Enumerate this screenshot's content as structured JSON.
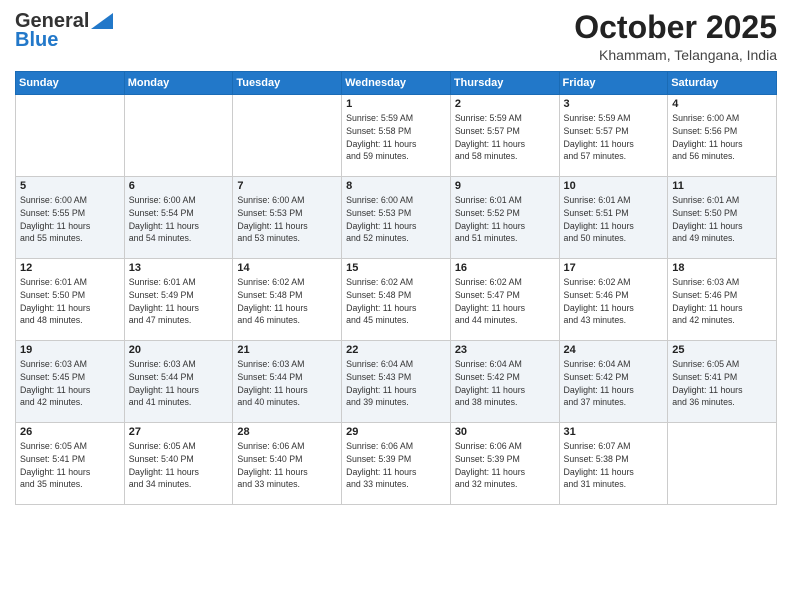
{
  "header": {
    "logo_general": "General",
    "logo_blue": "Blue",
    "month": "October 2025",
    "location": "Khammam, Telangana, India"
  },
  "weekdays": [
    "Sunday",
    "Monday",
    "Tuesday",
    "Wednesday",
    "Thursday",
    "Friday",
    "Saturday"
  ],
  "weeks": [
    [
      {
        "day": "",
        "info": ""
      },
      {
        "day": "",
        "info": ""
      },
      {
        "day": "",
        "info": ""
      },
      {
        "day": "1",
        "info": "Sunrise: 5:59 AM\nSunset: 5:58 PM\nDaylight: 11 hours\nand 59 minutes."
      },
      {
        "day": "2",
        "info": "Sunrise: 5:59 AM\nSunset: 5:57 PM\nDaylight: 11 hours\nand 58 minutes."
      },
      {
        "day": "3",
        "info": "Sunrise: 5:59 AM\nSunset: 5:57 PM\nDaylight: 11 hours\nand 57 minutes."
      },
      {
        "day": "4",
        "info": "Sunrise: 6:00 AM\nSunset: 5:56 PM\nDaylight: 11 hours\nand 56 minutes."
      }
    ],
    [
      {
        "day": "5",
        "info": "Sunrise: 6:00 AM\nSunset: 5:55 PM\nDaylight: 11 hours\nand 55 minutes."
      },
      {
        "day": "6",
        "info": "Sunrise: 6:00 AM\nSunset: 5:54 PM\nDaylight: 11 hours\nand 54 minutes."
      },
      {
        "day": "7",
        "info": "Sunrise: 6:00 AM\nSunset: 5:53 PM\nDaylight: 11 hours\nand 53 minutes."
      },
      {
        "day": "8",
        "info": "Sunrise: 6:00 AM\nSunset: 5:53 PM\nDaylight: 11 hours\nand 52 minutes."
      },
      {
        "day": "9",
        "info": "Sunrise: 6:01 AM\nSunset: 5:52 PM\nDaylight: 11 hours\nand 51 minutes."
      },
      {
        "day": "10",
        "info": "Sunrise: 6:01 AM\nSunset: 5:51 PM\nDaylight: 11 hours\nand 50 minutes."
      },
      {
        "day": "11",
        "info": "Sunrise: 6:01 AM\nSunset: 5:50 PM\nDaylight: 11 hours\nand 49 minutes."
      }
    ],
    [
      {
        "day": "12",
        "info": "Sunrise: 6:01 AM\nSunset: 5:50 PM\nDaylight: 11 hours\nand 48 minutes."
      },
      {
        "day": "13",
        "info": "Sunrise: 6:01 AM\nSunset: 5:49 PM\nDaylight: 11 hours\nand 47 minutes."
      },
      {
        "day": "14",
        "info": "Sunrise: 6:02 AM\nSunset: 5:48 PM\nDaylight: 11 hours\nand 46 minutes."
      },
      {
        "day": "15",
        "info": "Sunrise: 6:02 AM\nSunset: 5:48 PM\nDaylight: 11 hours\nand 45 minutes."
      },
      {
        "day": "16",
        "info": "Sunrise: 6:02 AM\nSunset: 5:47 PM\nDaylight: 11 hours\nand 44 minutes."
      },
      {
        "day": "17",
        "info": "Sunrise: 6:02 AM\nSunset: 5:46 PM\nDaylight: 11 hours\nand 43 minutes."
      },
      {
        "day": "18",
        "info": "Sunrise: 6:03 AM\nSunset: 5:46 PM\nDaylight: 11 hours\nand 42 minutes."
      }
    ],
    [
      {
        "day": "19",
        "info": "Sunrise: 6:03 AM\nSunset: 5:45 PM\nDaylight: 11 hours\nand 42 minutes."
      },
      {
        "day": "20",
        "info": "Sunrise: 6:03 AM\nSunset: 5:44 PM\nDaylight: 11 hours\nand 41 minutes."
      },
      {
        "day": "21",
        "info": "Sunrise: 6:03 AM\nSunset: 5:44 PM\nDaylight: 11 hours\nand 40 minutes."
      },
      {
        "day": "22",
        "info": "Sunrise: 6:04 AM\nSunset: 5:43 PM\nDaylight: 11 hours\nand 39 minutes."
      },
      {
        "day": "23",
        "info": "Sunrise: 6:04 AM\nSunset: 5:42 PM\nDaylight: 11 hours\nand 38 minutes."
      },
      {
        "day": "24",
        "info": "Sunrise: 6:04 AM\nSunset: 5:42 PM\nDaylight: 11 hours\nand 37 minutes."
      },
      {
        "day": "25",
        "info": "Sunrise: 6:05 AM\nSunset: 5:41 PM\nDaylight: 11 hours\nand 36 minutes."
      }
    ],
    [
      {
        "day": "26",
        "info": "Sunrise: 6:05 AM\nSunset: 5:41 PM\nDaylight: 11 hours\nand 35 minutes."
      },
      {
        "day": "27",
        "info": "Sunrise: 6:05 AM\nSunset: 5:40 PM\nDaylight: 11 hours\nand 34 minutes."
      },
      {
        "day": "28",
        "info": "Sunrise: 6:06 AM\nSunset: 5:40 PM\nDaylight: 11 hours\nand 33 minutes."
      },
      {
        "day": "29",
        "info": "Sunrise: 6:06 AM\nSunset: 5:39 PM\nDaylight: 11 hours\nand 33 minutes."
      },
      {
        "day": "30",
        "info": "Sunrise: 6:06 AM\nSunset: 5:39 PM\nDaylight: 11 hours\nand 32 minutes."
      },
      {
        "day": "31",
        "info": "Sunrise: 6:07 AM\nSunset: 5:38 PM\nDaylight: 11 hours\nand 31 minutes."
      },
      {
        "day": "",
        "info": ""
      }
    ]
  ]
}
